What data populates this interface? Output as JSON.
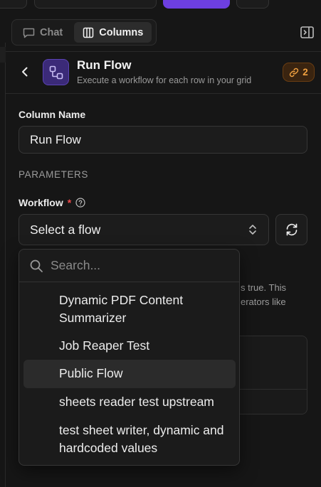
{
  "tabs": [
    {
      "label": "Chat",
      "active": false
    },
    {
      "label": "Columns",
      "active": true
    }
  ],
  "header": {
    "title": "Run Flow",
    "subtitle": "Execute a workflow for each row in your grid",
    "badge_count": "2"
  },
  "form": {
    "column_name_label": "Column Name",
    "column_name_value": "Run Flow",
    "section_label": "PARAMETERS",
    "workflow_label": "Workflow",
    "required_mark": "*",
    "select_value": "Select a flow"
  },
  "background": {
    "line1": "s true. This",
    "line2": "erators like"
  },
  "dropdown": {
    "search_placeholder": "Search...",
    "options": [
      {
        "label": "Dynamic PDF Content Summarizer",
        "line1": "Dynamic PDF Content",
        "line2": "Summarizer",
        "highlighted": false
      },
      {
        "label": "Job Reaper Test",
        "highlighted": false
      },
      {
        "label": "Public Flow",
        "highlighted": true
      },
      {
        "label": "sheets reader test upstream",
        "highlighted": false
      },
      {
        "label": "test sheet writer, dynamic and hardcoded values",
        "line1": "test sheet writer, dynamic and",
        "line2": "hardcoded values",
        "highlighted": false
      }
    ]
  },
  "colors": {
    "accent": "#6d3fe0",
    "badge_text": "#f0a040",
    "required": "#ef4b4b"
  }
}
